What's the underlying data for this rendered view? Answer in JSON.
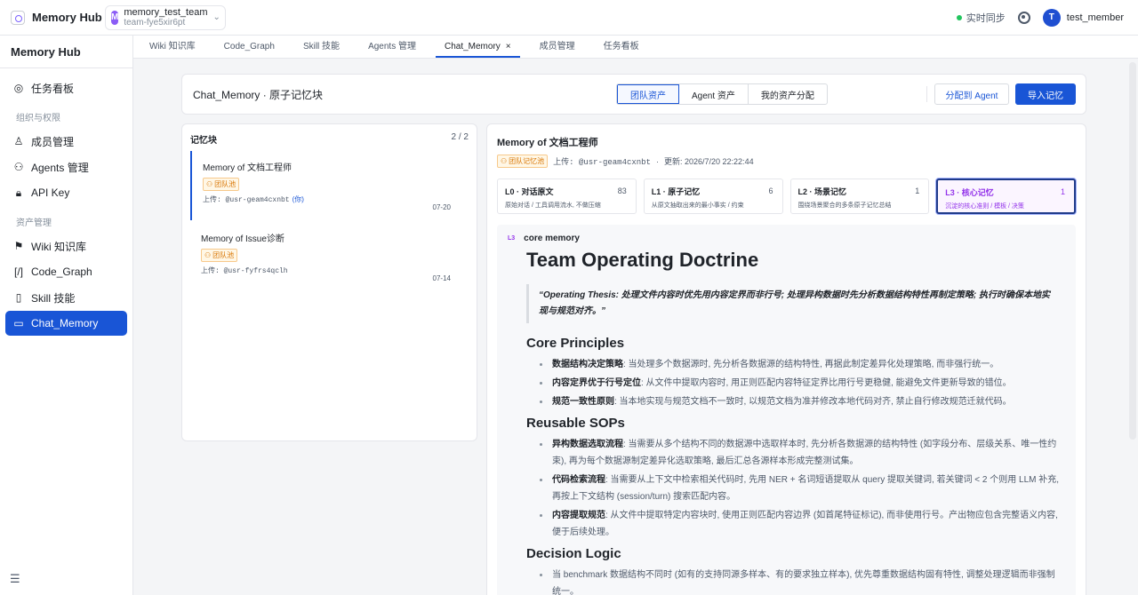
{
  "topbar": {
    "brand": "Memory Hub",
    "team": {
      "avatar": "M",
      "name": "memory_test_team",
      "id": "team-fye5xir6pt"
    },
    "sync": "实时同步",
    "user": {
      "avatar": "T",
      "name": "test_member"
    }
  },
  "sidebar": {
    "title": "Memory Hub",
    "items": [
      {
        "label": "任务看板",
        "icon": "target-icon"
      }
    ],
    "sections": [
      {
        "title": "组织与权限",
        "items": [
          {
            "label": "成员管理",
            "icon": "user-icon"
          },
          {
            "label": "Agents 管理",
            "icon": "users-icon"
          },
          {
            "label": "API Key",
            "icon": "lock-icon"
          }
        ]
      },
      {
        "title": "资产管理",
        "items": [
          {
            "label": "Wiki 知识库",
            "icon": "bookmark-icon"
          },
          {
            "label": "Code_Graph",
            "icon": "code-icon"
          },
          {
            "label": "Skill 技能",
            "icon": "book-icon"
          },
          {
            "label": "Chat_Memory",
            "icon": "chat-icon"
          }
        ]
      }
    ]
  },
  "tabs": [
    "Wiki 知识库",
    "Code_Graph",
    "Skill 技能",
    "Agents 管理",
    "Chat_Memory",
    "成员管理",
    "任务看板"
  ],
  "tab_close": "×",
  "header": {
    "title": "Chat_Memory · 原子记忆块",
    "segments": [
      "团队资产",
      "Agent 资产",
      "我的资产分配"
    ],
    "assign_button": "分配到 Agent",
    "import_button": "导入记忆"
  },
  "list": {
    "title": "记忆块",
    "count": "2 / 2",
    "items": [
      {
        "title": "Memory of 文档工程师",
        "tag": "团队池",
        "uploader": "上传: @usr-geam4cxnbt",
        "you": "(你)",
        "date": "07-20"
      },
      {
        "title": "Memory of Issue诊断",
        "tag": "团队池",
        "uploader": "上传: @usr-fyfrs4qclh",
        "you": "",
        "date": "07-14"
      }
    ]
  },
  "detail": {
    "title": "Memory of 文档工程师",
    "tag": "团队记忆池",
    "uploader": "上传: @usr-geam4cxnbt",
    "dot": "·",
    "updated": "更新: 2026/7/20 22:22:44",
    "levels": [
      {
        "name": "L0 · 对话原文",
        "count": "83",
        "desc": "原始对话 / 工具调用流水, 不做压缩"
      },
      {
        "name": "L1 · 原子记忆",
        "count": "6",
        "desc": "从原文抽取出来的最小事实 / 约束"
      },
      {
        "name": "L2 · 场景记忆",
        "count": "1",
        "desc": "围绕场景聚合的多条原子记忆总结"
      },
      {
        "name": "L3 · 核心记忆",
        "count": "1",
        "desc": "沉淀的核心准则 / 模板 / 决策"
      }
    ],
    "doc": {
      "badge": "L3",
      "kind": "core memory",
      "h1": "Team Operating Doctrine",
      "quote": "“Operating Thesis: 处理文件内容时优先用内容定界而非行号; 处理异构数据时先分析数据结构特性再制定策略; 执行时确保本地实现与规范对齐。”",
      "sections": [
        {
          "heading": "Core Principles",
          "items": [
            {
              "bold": "数据结构决定策略",
              "text": ": 当处理多个数据源时, 先分析各数据源的结构特性, 再据此制定差异化处理策略, 而非强行统一。"
            },
            {
              "bold": "内容定界优于行号定位",
              "text": ": 从文件中提取内容时, 用正则匹配内容特征定界比用行号更稳健, 能避免文件更新导致的错位。"
            },
            {
              "bold": "规范一致性原则",
              "text": ": 当本地实现与规范文档不一致时, 以规范文档为准并修改本地代码对齐, 禁止自行修改规范迁就代码。"
            }
          ]
        },
        {
          "heading": "Reusable SOPs",
          "items": [
            {
              "bold": "异构数据选取流程",
              "text": ": 当需要从多个结构不同的数据源中选取样本时, 先分析各数据源的结构特性 (如字段分布、层级关系、唯一性约束), 再为每个数据源制定差异化选取策略, 最后汇总各源样本形成完整测试集。"
            },
            {
              "bold": "代码检索流程",
              "text": ": 当需要从上下文中检索相关代码时, 先用 NER + 名词短语提取从 query 提取关键词, 若关键词 < 2 个则用 LLM 补充, 再按上下文结构 (session/turn) 搜索匹配内容。"
            },
            {
              "bold": "内容提取规范",
              "text": ": 从文件中提取特定内容块时, 使用正则匹配内容边界 (如首尾特征标记), 而非使用行号。产出物应包含完整语义内容, 便于后续处理。"
            }
          ]
        },
        {
          "heading": "Decision Logic",
          "items": [
            {
              "bold": "",
              "text": "当 benchmark 数据结构不同时 (如有的支持同源多样本、有的要求独立样本), 优先尊重数据结构固有特性, 调整处理逻辑而非强制统一。"
            }
          ]
        }
      ]
    }
  },
  "footer_icon": "menu-icon"
}
